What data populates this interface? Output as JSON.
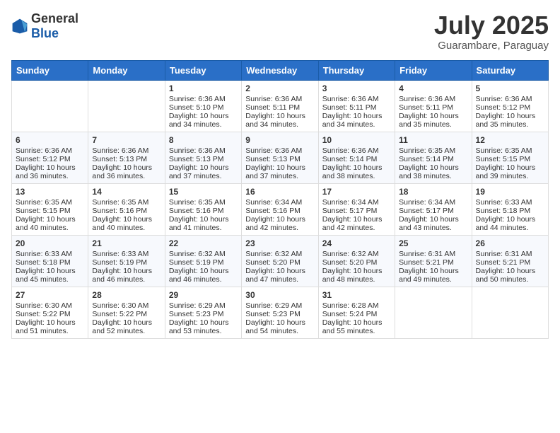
{
  "header": {
    "logo_general": "General",
    "logo_blue": "Blue",
    "month_year": "July 2025",
    "location": "Guarambare, Paraguay"
  },
  "weekdays": [
    "Sunday",
    "Monday",
    "Tuesday",
    "Wednesday",
    "Thursday",
    "Friday",
    "Saturday"
  ],
  "weeks": [
    [
      {
        "day": "",
        "sunrise": "",
        "sunset": "",
        "daylight": ""
      },
      {
        "day": "",
        "sunrise": "",
        "sunset": "",
        "daylight": ""
      },
      {
        "day": "1",
        "sunrise": "Sunrise: 6:36 AM",
        "sunset": "Sunset: 5:10 PM",
        "daylight": "Daylight: 10 hours and 34 minutes."
      },
      {
        "day": "2",
        "sunrise": "Sunrise: 6:36 AM",
        "sunset": "Sunset: 5:11 PM",
        "daylight": "Daylight: 10 hours and 34 minutes."
      },
      {
        "day": "3",
        "sunrise": "Sunrise: 6:36 AM",
        "sunset": "Sunset: 5:11 PM",
        "daylight": "Daylight: 10 hours and 34 minutes."
      },
      {
        "day": "4",
        "sunrise": "Sunrise: 6:36 AM",
        "sunset": "Sunset: 5:11 PM",
        "daylight": "Daylight: 10 hours and 35 minutes."
      },
      {
        "day": "5",
        "sunrise": "Sunrise: 6:36 AM",
        "sunset": "Sunset: 5:12 PM",
        "daylight": "Daylight: 10 hours and 35 minutes."
      }
    ],
    [
      {
        "day": "6",
        "sunrise": "Sunrise: 6:36 AM",
        "sunset": "Sunset: 5:12 PM",
        "daylight": "Daylight: 10 hours and 36 minutes."
      },
      {
        "day": "7",
        "sunrise": "Sunrise: 6:36 AM",
        "sunset": "Sunset: 5:13 PM",
        "daylight": "Daylight: 10 hours and 36 minutes."
      },
      {
        "day": "8",
        "sunrise": "Sunrise: 6:36 AM",
        "sunset": "Sunset: 5:13 PM",
        "daylight": "Daylight: 10 hours and 37 minutes."
      },
      {
        "day": "9",
        "sunrise": "Sunrise: 6:36 AM",
        "sunset": "Sunset: 5:13 PM",
        "daylight": "Daylight: 10 hours and 37 minutes."
      },
      {
        "day": "10",
        "sunrise": "Sunrise: 6:36 AM",
        "sunset": "Sunset: 5:14 PM",
        "daylight": "Daylight: 10 hours and 38 minutes."
      },
      {
        "day": "11",
        "sunrise": "Sunrise: 6:35 AM",
        "sunset": "Sunset: 5:14 PM",
        "daylight": "Daylight: 10 hours and 38 minutes."
      },
      {
        "day": "12",
        "sunrise": "Sunrise: 6:35 AM",
        "sunset": "Sunset: 5:15 PM",
        "daylight": "Daylight: 10 hours and 39 minutes."
      }
    ],
    [
      {
        "day": "13",
        "sunrise": "Sunrise: 6:35 AM",
        "sunset": "Sunset: 5:15 PM",
        "daylight": "Daylight: 10 hours and 40 minutes."
      },
      {
        "day": "14",
        "sunrise": "Sunrise: 6:35 AM",
        "sunset": "Sunset: 5:16 PM",
        "daylight": "Daylight: 10 hours and 40 minutes."
      },
      {
        "day": "15",
        "sunrise": "Sunrise: 6:35 AM",
        "sunset": "Sunset: 5:16 PM",
        "daylight": "Daylight: 10 hours and 41 minutes."
      },
      {
        "day": "16",
        "sunrise": "Sunrise: 6:34 AM",
        "sunset": "Sunset: 5:16 PM",
        "daylight": "Daylight: 10 hours and 42 minutes."
      },
      {
        "day": "17",
        "sunrise": "Sunrise: 6:34 AM",
        "sunset": "Sunset: 5:17 PM",
        "daylight": "Daylight: 10 hours and 42 minutes."
      },
      {
        "day": "18",
        "sunrise": "Sunrise: 6:34 AM",
        "sunset": "Sunset: 5:17 PM",
        "daylight": "Daylight: 10 hours and 43 minutes."
      },
      {
        "day": "19",
        "sunrise": "Sunrise: 6:33 AM",
        "sunset": "Sunset: 5:18 PM",
        "daylight": "Daylight: 10 hours and 44 minutes."
      }
    ],
    [
      {
        "day": "20",
        "sunrise": "Sunrise: 6:33 AM",
        "sunset": "Sunset: 5:18 PM",
        "daylight": "Daylight: 10 hours and 45 minutes."
      },
      {
        "day": "21",
        "sunrise": "Sunrise: 6:33 AM",
        "sunset": "Sunset: 5:19 PM",
        "daylight": "Daylight: 10 hours and 46 minutes."
      },
      {
        "day": "22",
        "sunrise": "Sunrise: 6:32 AM",
        "sunset": "Sunset: 5:19 PM",
        "daylight": "Daylight: 10 hours and 46 minutes."
      },
      {
        "day": "23",
        "sunrise": "Sunrise: 6:32 AM",
        "sunset": "Sunset: 5:20 PM",
        "daylight": "Daylight: 10 hours and 47 minutes."
      },
      {
        "day": "24",
        "sunrise": "Sunrise: 6:32 AM",
        "sunset": "Sunset: 5:20 PM",
        "daylight": "Daylight: 10 hours and 48 minutes."
      },
      {
        "day": "25",
        "sunrise": "Sunrise: 6:31 AM",
        "sunset": "Sunset: 5:21 PM",
        "daylight": "Daylight: 10 hours and 49 minutes."
      },
      {
        "day": "26",
        "sunrise": "Sunrise: 6:31 AM",
        "sunset": "Sunset: 5:21 PM",
        "daylight": "Daylight: 10 hours and 50 minutes."
      }
    ],
    [
      {
        "day": "27",
        "sunrise": "Sunrise: 6:30 AM",
        "sunset": "Sunset: 5:22 PM",
        "daylight": "Daylight: 10 hours and 51 minutes."
      },
      {
        "day": "28",
        "sunrise": "Sunrise: 6:30 AM",
        "sunset": "Sunset: 5:22 PM",
        "daylight": "Daylight: 10 hours and 52 minutes."
      },
      {
        "day": "29",
        "sunrise": "Sunrise: 6:29 AM",
        "sunset": "Sunset: 5:23 PM",
        "daylight": "Daylight: 10 hours and 53 minutes."
      },
      {
        "day": "30",
        "sunrise": "Sunrise: 6:29 AM",
        "sunset": "Sunset: 5:23 PM",
        "daylight": "Daylight: 10 hours and 54 minutes."
      },
      {
        "day": "31",
        "sunrise": "Sunrise: 6:28 AM",
        "sunset": "Sunset: 5:24 PM",
        "daylight": "Daylight: 10 hours and 55 minutes."
      },
      {
        "day": "",
        "sunrise": "",
        "sunset": "",
        "daylight": ""
      },
      {
        "day": "",
        "sunrise": "",
        "sunset": "",
        "daylight": ""
      }
    ]
  ]
}
